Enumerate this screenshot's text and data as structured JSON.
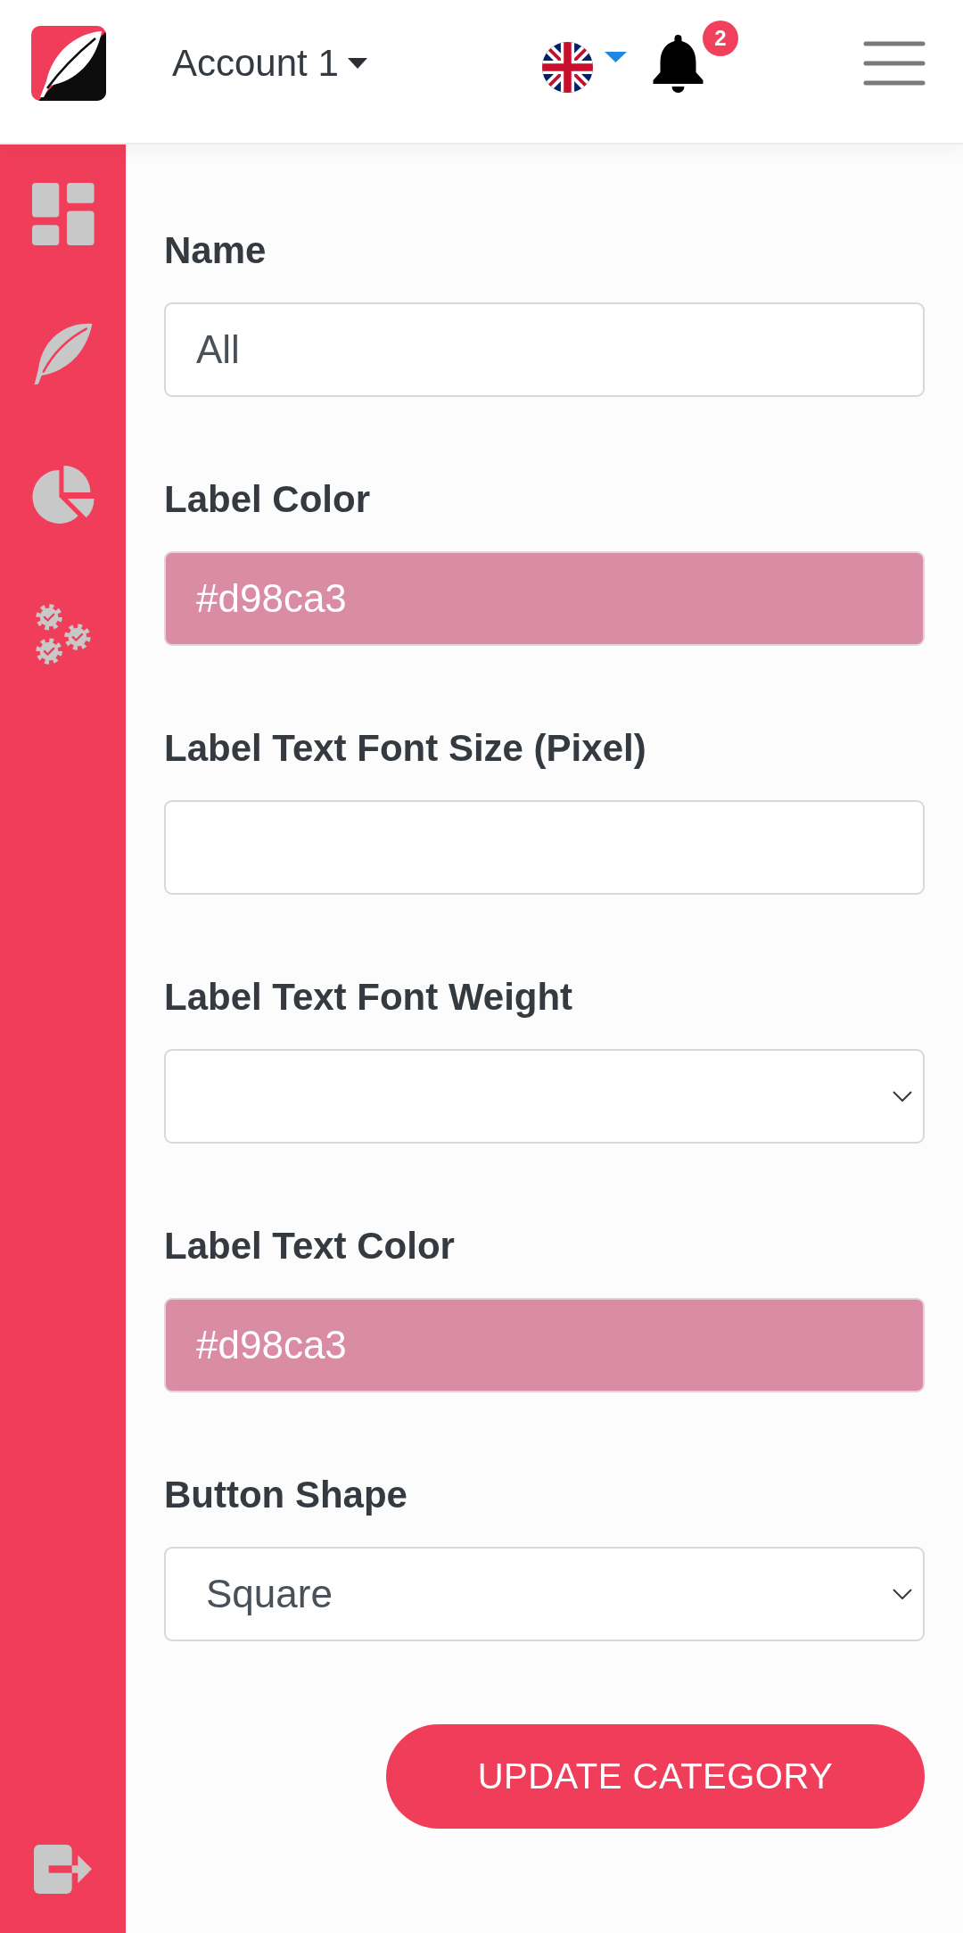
{
  "header": {
    "account": {
      "label": "Account 1"
    },
    "notifications": {
      "badge": "2"
    }
  },
  "form": {
    "fields": [
      {
        "kind": "text",
        "label": "Name",
        "value": "All"
      },
      {
        "kind": "color",
        "label": "Label Color",
        "value": "#d98ca3",
        "color": "#d98ca3"
      },
      {
        "kind": "text",
        "label": "Label Text Font Size (Pixel)"
      },
      {
        "kind": "select",
        "label": "Label Text Font Weight"
      },
      {
        "kind": "color",
        "label": "Label Text Color",
        "value": "#d98ca3",
        "color": "#d98ca3"
      },
      {
        "kind": "select",
        "label": "Button Shape",
        "value": "Square"
      }
    ],
    "submit": {
      "label": "UPDATE CATEGORY"
    }
  }
}
